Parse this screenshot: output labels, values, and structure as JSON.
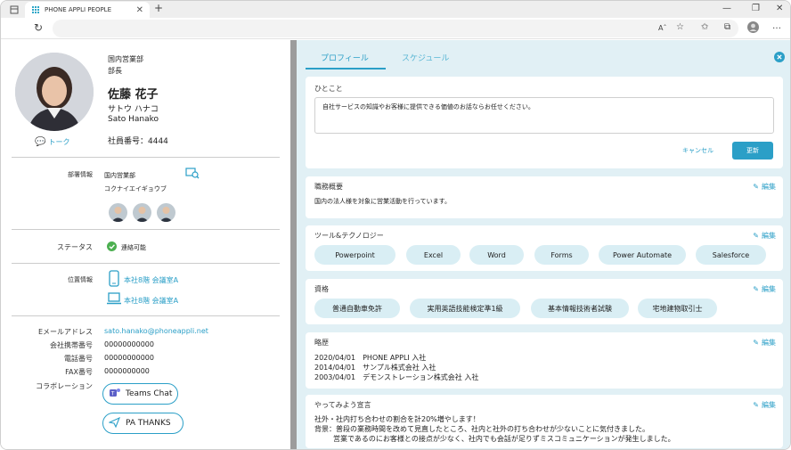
{
  "browser": {
    "tab_title": "PHONE APPLI PEOPLE",
    "tab_close": "✕",
    "new_tab": "+",
    "win_minimize": "—",
    "win_restore": "❐",
    "win_close": "✕",
    "reader_icon_text": "Aˆ"
  },
  "profile": {
    "department": "国内営業部",
    "position": "部長",
    "name": "佐藤 花子",
    "name_kana": "サトウ ハナコ",
    "name_roman": "Sato Hanako",
    "employee_no": "社員番号：4444",
    "talk_label": "トーク"
  },
  "dept_info": {
    "label": "部署情報",
    "name": "国内営業部",
    "kana": "コクナイエイギョウブ"
  },
  "status": {
    "label": "ステータス",
    "value": "連絡可能",
    "color": "#4caf50"
  },
  "location": {
    "label": "位置情報",
    "items": [
      "本社8階 会議室A",
      "本社8階 会議室A"
    ]
  },
  "contacts": {
    "email_label": "Eメールアドレス",
    "email": "sato.hanako@phoneappli.net",
    "mobile_label": "会社携帯番号",
    "mobile": "00000000000",
    "phone_label": "電話番号",
    "phone": "00000000000",
    "fax_label": "FAX番号",
    "fax": "0000000000",
    "collab_label": "コラボレーション",
    "teams_label": "Teams Chat",
    "thanks_label": "PA THANKS"
  },
  "tabs": {
    "profile": "プロフィール",
    "schedule": "スケジュール"
  },
  "comment": {
    "title": "ひとこと",
    "text": "自社サービスの知識やお客様に提供できる価値のお話ならお任せください。",
    "cancel": "キャンセル",
    "update": "更新"
  },
  "edit_label": "編集",
  "duties": {
    "title": "職務概要",
    "text": "国内の法人様を対象に営業活動を行っています。"
  },
  "tools": {
    "title": "ツール&テクノロジー",
    "items": [
      "Powerpoint",
      "Excel",
      "Word",
      "Forms",
      "Power Automate",
      "Salesforce"
    ]
  },
  "qualifications": {
    "title": "資格",
    "items": [
      "普通自動車免許",
      "実用英語技能検定準1級",
      "基本情報技術者試験",
      "宅地建物取引士"
    ]
  },
  "history": {
    "title": "略歴",
    "items": [
      "2020/04/01　PHONE APPLI 入社",
      "2014/04/01　サンプル株式会社 入社",
      "2003/04/01　デモンストレーション株式会社 入社"
    ]
  },
  "declaration": {
    "title": "やってみよう宣言",
    "line1": "社外・社内打ち合わせの割合を計20%増やします！",
    "line2": "背景：普段の業務時間を改めて見直したところ、社内と社外の打ち合わせが少ないことに気付きました。",
    "line3": "営業であるのにお客様との接点が少なく、社内でも会話が足りずミスコミュニケーションが発生しました。"
  },
  "colors": {
    "accent": "#2b9fc7",
    "panel_bg": "#e1f0f5",
    "pill_bg": "#d9eef4"
  }
}
